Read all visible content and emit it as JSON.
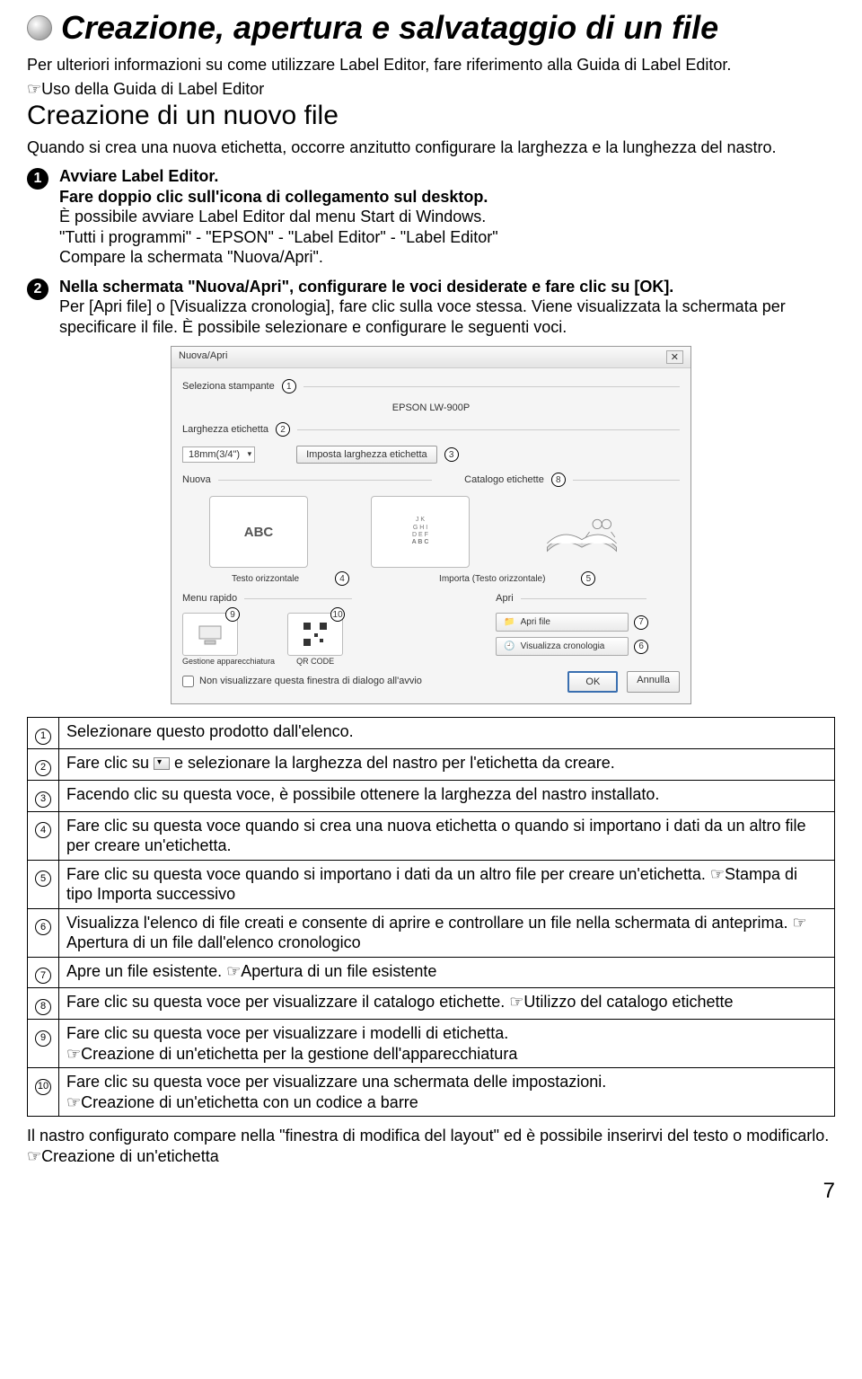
{
  "title": "Creazione, apertura e salvataggio di un file",
  "intro": "Per ulteriori informazioni su come utilizzare Label Editor, fare riferimento alla Guida di Label Editor.",
  "ref1": "Uso della Guida di Label Editor",
  "h2": "Creazione di un nuovo file",
  "subintro": "Quando si crea una nuova etichetta, occorre anzitutto configurare la larghezza e la lunghezza del nastro.",
  "step1": {
    "b1": "Avviare Label Editor.",
    "b2": "Fare doppio clic sull'icona di collegamento sul desktop.",
    "l1": "È possibile avviare Label Editor dal menu Start di Windows.",
    "l2": "\"Tutti i programmi\" - \"EPSON\" - \"Label Editor\" - \"Label Editor\"",
    "l3": "Compare la schermata \"Nuova/Apri\"."
  },
  "step2": {
    "b1": "Nella schermata \"Nuova/Apri\", configurare le voci desiderate e fare clic su [OK].",
    "l1": "Per [Apri file] o [Visualizza cronologia], fare clic sulla voce stessa. Viene visualizzata la schermata per specificare il file. È possibile selezionare e configurare le seguenti voci."
  },
  "dialog": {
    "title": "Nuova/Apri",
    "sel_stamp": "Seleziona stampante",
    "printer": "EPSON LW-900P",
    "larg": "Larghezza etichetta",
    "width": "18mm(3/4\")",
    "imp_larg": "Imposta larghezza etichetta",
    "nuova": "Nuova",
    "catalogo": "Catalogo etichette",
    "testo_or": "Testo orizzontale",
    "importa": "Importa (Testo orizzontale)",
    "menu_rap": "Menu rapido",
    "apri": "Apri",
    "apri_file": "Apri file",
    "vis_cron": "Visualizza cronologia",
    "gestione": "Gestione apparecchiatura",
    "qr": "QR CODE",
    "nonvis": "Non visualizzare questa finestra di dialogo all'avvio",
    "ok": "OK",
    "annulla": "Annulla"
  },
  "table": [
    "Selezionare questo prodotto dall'elenco.",
    "Fare clic su |DD| e selezionare la larghezza del nastro per l'etichetta da creare.",
    "Facendo clic su questa voce, è possibile ottenere la larghezza del nastro installato.",
    "Fare clic su questa voce quando si crea una nuova etichetta o quando si importano i dati da un altro file per creare un'etichetta.",
    "Fare clic su questa voce quando si importano i dati da un altro file per creare un'etichetta. ☞Stampa di tipo Importa successivo",
    "Visualizza l'elenco di file creati e consente di aprire e controllare un file nella schermata di anteprima. ☞Apertura di un file dall'elenco cronologico",
    "Apre un file esistente. ☞Apertura di un file esistente",
    "Fare clic su questa voce per visualizzare il catalogo etichette. ☞Utilizzo del catalogo etichette",
    "Fare clic su questa voce per visualizzare i modelli di etichetta.\n☞Creazione di un'etichetta per la gestione dell'apparecchiatura",
    "Fare clic su questa voce per visualizzare una schermata delle impostazioni.\n☞Creazione di un'etichetta con un codice a barre"
  ],
  "outro": "Il nastro configurato compare nella \"finestra di modifica del layout\" ed è possibile inserirvi del testo o modificarlo. ☞Creazione di un'etichetta",
  "page": "7"
}
